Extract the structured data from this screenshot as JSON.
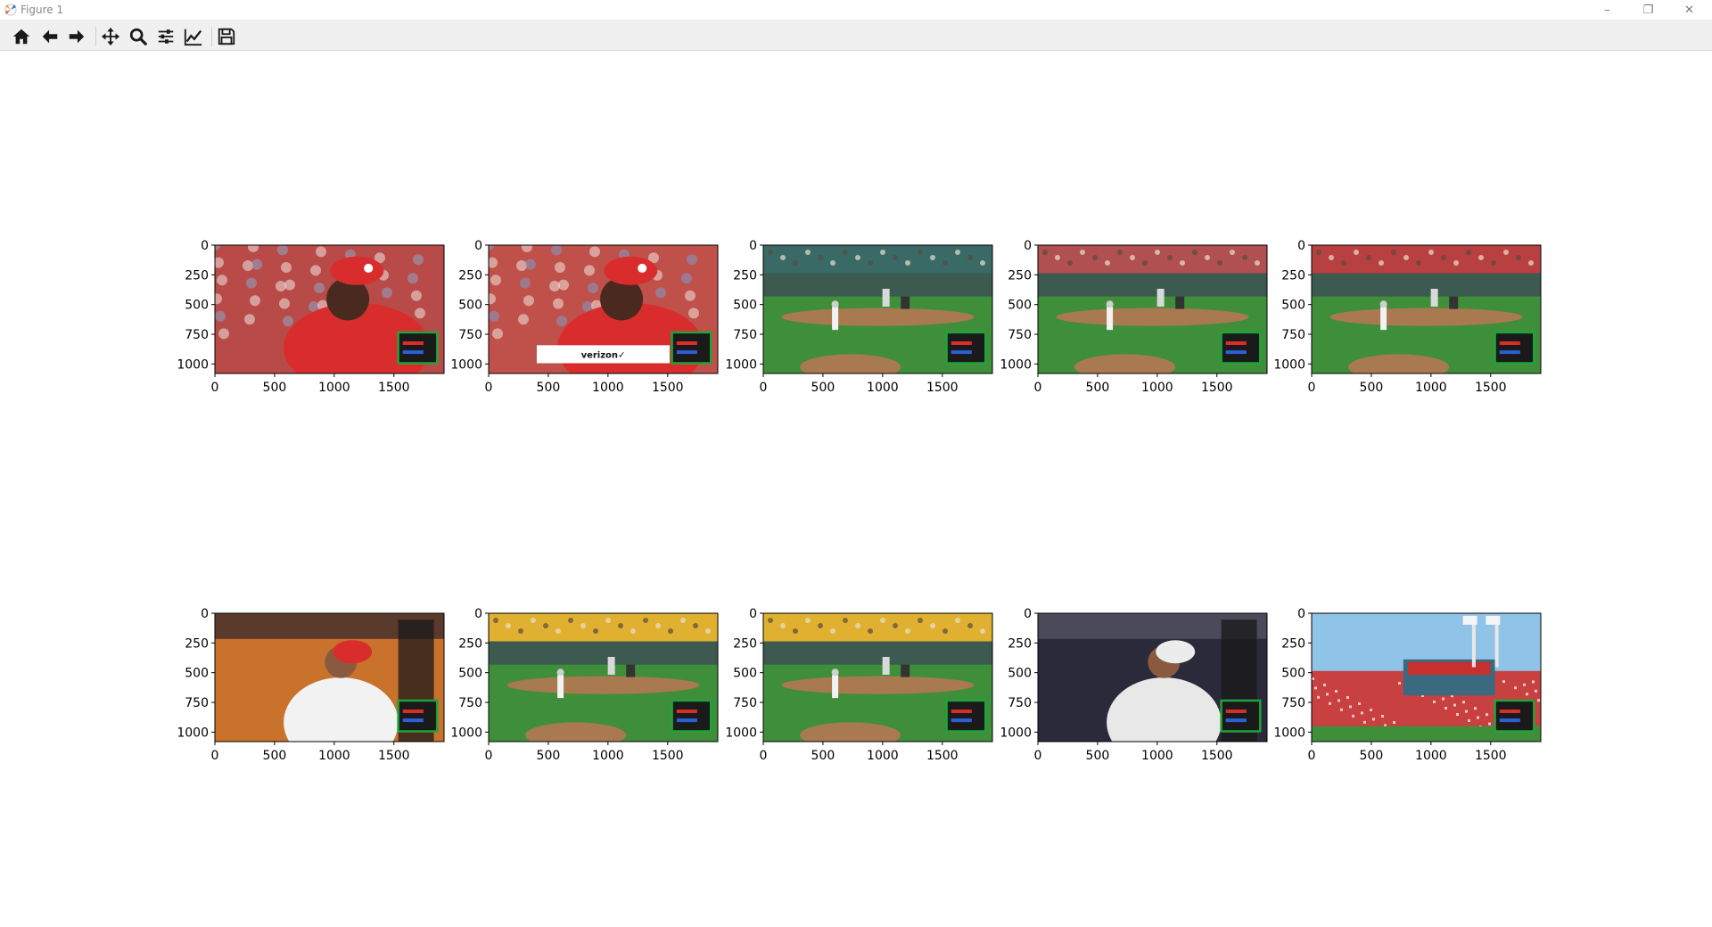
{
  "window": {
    "title": "Figure 1",
    "controls": {
      "minimize": "–",
      "maximize": "❐",
      "close": "✕"
    }
  },
  "toolbar": {
    "items": [
      {
        "name": "home",
        "icon": "home-icon"
      },
      {
        "name": "back",
        "icon": "back-arrow-icon"
      },
      {
        "name": "forward",
        "icon": "forward-arrow-icon"
      },
      {
        "name": "pan",
        "icon": "pan-move-icon"
      },
      {
        "name": "zoom",
        "icon": "zoom-magnifier-icon"
      },
      {
        "name": "configure-subplots",
        "icon": "sliders-icon"
      },
      {
        "name": "edit-axes",
        "icon": "line-chart-icon"
      },
      {
        "name": "save",
        "icon": "floppy-disk-icon"
      }
    ]
  },
  "figure": {
    "rows": 2,
    "cols": 5,
    "x_ticks": [
      "0",
      "500",
      "1000",
      "1500"
    ],
    "y_ticks": [
      "0",
      "250",
      "500",
      "750",
      "1000"
    ],
    "image_width": 1920,
    "image_height": 1080,
    "ad_text": "verizon✓",
    "panels": [
      {
        "scene": "closeup",
        "bg": "#b84a48",
        "accent": "#d92d2d",
        "crowd": "#8fa6c7"
      },
      {
        "scene": "closeup",
        "bg": "#c0504a",
        "accent": "#d92d2d",
        "crowd": "#7d9ac7",
        "ad": true
      },
      {
        "scene": "field",
        "bg": "#2e5d55",
        "accent": "#3f8f3a",
        "crowd": "#3a6a66"
      },
      {
        "scene": "field",
        "bg": "#7a3a3a",
        "accent": "#3f8f3a",
        "crowd": "#b05050"
      },
      {
        "scene": "field",
        "bg": "#7a3535",
        "accent": "#3f8f3a",
        "crowd": "#b84040"
      },
      {
        "scene": "batter",
        "bg": "#c9722c",
        "accent": "#f2f2f2",
        "crowd": "#5a3a2a"
      },
      {
        "scene": "field",
        "bg": "#2a3a5a",
        "accent": "#3f8f3a",
        "crowd": "#e0b030"
      },
      {
        "scene": "field",
        "bg": "#2a3a5a",
        "accent": "#3f8f3a",
        "crowd": "#e0b030"
      },
      {
        "scene": "batter",
        "bg": "#2a2a3a",
        "accent": "#e8e8e8",
        "crowd": "#4a4a5a"
      },
      {
        "scene": "stadium",
        "bg": "#8fc3e8",
        "accent": "#3f8f3a",
        "crowd": "#c84040"
      }
    ]
  }
}
